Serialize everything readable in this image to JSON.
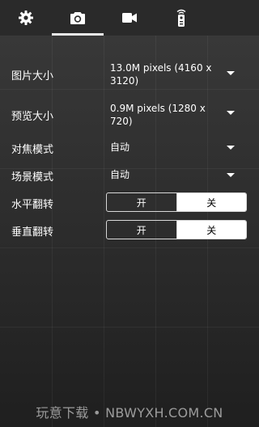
{
  "tabs": [
    {
      "icon": "gear-icon"
    },
    {
      "icon": "camera-icon",
      "active": true
    },
    {
      "icon": "video-camera-icon"
    },
    {
      "icon": "remote-control-icon"
    }
  ],
  "settings": {
    "picture_size": {
      "label": "图片大小",
      "value": "13.0M pixels (4160  x 3120)"
    },
    "preview_size": {
      "label": "预览大小",
      "value": "0.9M pixels (1280  x 720)"
    },
    "focus_mode": {
      "label": "对焦模式",
      "value": "自动"
    },
    "scene_mode": {
      "label": "场景模式",
      "value": "自动"
    },
    "horizontal_flip": {
      "label": "水平翻转",
      "on": "开",
      "off": "关",
      "selected": "关"
    },
    "vertical_flip": {
      "label": "垂直翻转",
      "on": "开",
      "off": "关",
      "selected": "关"
    }
  },
  "watermark": "玩意下载 • NBWYXH.COM.CN",
  "colors": {
    "background": "#2c2c2c",
    "topbar": "#2a2a2a",
    "text": "#ffffff",
    "selected_segment": "#ffffff"
  }
}
